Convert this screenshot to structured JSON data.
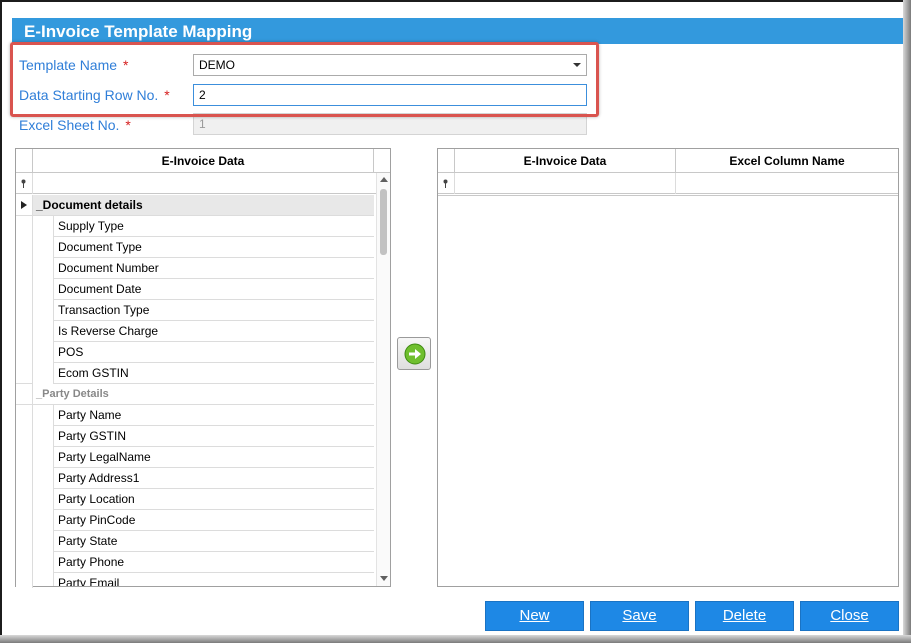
{
  "window": {
    "title": "E-Invoice Template Mapping"
  },
  "form": {
    "template_name": {
      "label": "Template Name",
      "required_mark": "*",
      "value": "DEMO"
    },
    "data_starting_row": {
      "label": "Data Starting Row No.",
      "required_mark": "*",
      "value": "2"
    },
    "excel_sheet_no": {
      "label": "Excel Sheet No.",
      "required_mark": "*",
      "value": "1"
    }
  },
  "left_grid": {
    "header": "E-Invoice Data",
    "groups": [
      {
        "title": "_Document details",
        "items": [
          "Supply Type",
          "Document Type",
          "Document Number",
          "Document Date",
          "Transaction Type",
          "Is Reverse Charge",
          "POS",
          "Ecom GSTIN"
        ]
      },
      {
        "title": "_Party Details",
        "items": [
          "Party Name",
          "Party GSTIN",
          "Party LegalName",
          "Party Address1",
          "Party Location",
          "Party PinCode",
          "Party State",
          "Party Phone",
          "Party Email"
        ]
      }
    ]
  },
  "right_grid": {
    "headers": [
      "E-Invoice Data",
      "Excel Column Name"
    ]
  },
  "buttons": {
    "new": "New",
    "save": "Save",
    "delete": "Delete",
    "close": "Close"
  },
  "colors": {
    "title_bar": "#3399dd",
    "label": "#2f7ed8",
    "required": "#d62020",
    "button": "#1e88e5",
    "highlight": "#d9544f"
  }
}
